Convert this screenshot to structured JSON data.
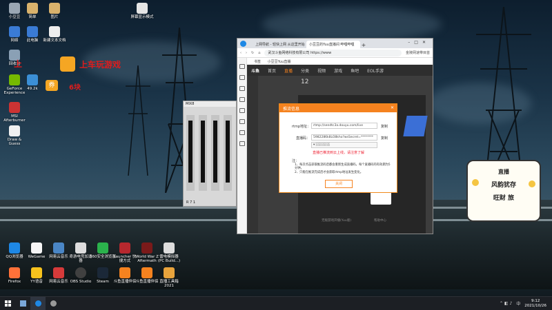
{
  "desktop": {
    "icons": [
      {
        "label": "小豆豆",
        "color": "#9aa7b4"
      },
      {
        "label": "简单",
        "color": "#d9b26c"
      },
      {
        "label": "图片",
        "color": "#d9b26c"
      },
      {
        "label": "网络",
        "color": "#3a7bd5"
      },
      {
        "label": "此电脑",
        "color": "#3a7bd5"
      },
      {
        "label": "新建文本文档",
        "color": "#eeeeee"
      },
      {
        "label": "回收站",
        "color": "#8aa0b5"
      },
      {
        "label": "49.2k",
        "color": "#3b8fd6"
      },
      {
        "label": "GeForce Experience",
        "color": "#76b900"
      },
      {
        "label": "MSI Afterburner",
        "color": "#c33"
      },
      {
        "label": "Draw & Guess",
        "color": "#f0f0f0"
      },
      {
        "label": "屏幕显示模式",
        "color": "#e5e5e5"
      },
      {
        "label": "QQ浏览器",
        "color": "#1e88e5"
      },
      {
        "label": "WeGame",
        "color": "#f5f5f5"
      },
      {
        "label": "网易云音乐",
        "color": "#4a86c5"
      },
      {
        "label": "奇游电竞加速器",
        "color": "#ddd"
      },
      {
        "label": "360安全浏览器",
        "color": "#2bb24c"
      },
      {
        "label": "Launcher 快捷方式",
        "color": "#b7282e"
      },
      {
        "label": "World War Z Aftermath",
        "color": "#7a1a1a"
      },
      {
        "label": "雷电模拟器 (PC Build...)",
        "color": "#ddd"
      },
      {
        "label": "Firefox",
        "color": "#ff7139"
      },
      {
        "label": "YY语音",
        "color": "#f8c31d"
      },
      {
        "label": "网易云音乐",
        "color": "#d63a3a"
      },
      {
        "label": "OBS Studio",
        "color": "#404040"
      },
      {
        "label": "Steam",
        "color": "#1b2838"
      },
      {
        "label": "斗鱼直播伴侣",
        "color": "#f5821f"
      },
      {
        "label": "斗鱼直播伴侣",
        "color": "#f5821f"
      },
      {
        "label": "直播工具箱 2021",
        "color": "#e8a33c"
      }
    ],
    "banner1_prefix": "上",
    "banner1_text": "上车玩游戏",
    "banner2_text": "券",
    "banner2_value": "6块"
  },
  "browser": {
    "tabs": [
      {
        "title": "上网导航 - 轻快上网 从这里开始"
      },
      {
        "title": "小豆豆的Yuu直播间 哔哩哔哩"
      }
    ],
    "address_url": "武汉斗鱼网络科技有限公司 https://www",
    "address_right": "金陵网速带目首",
    "bookmark": "书签",
    "bookmark2": "小豆豆Yuu直播",
    "site_nav": [
      "首页",
      "直播",
      "分类",
      "视频",
      "游戏",
      "鱼吧",
      "EOL手游"
    ],
    "score": "12",
    "footer_left": "无敌游戏开播(Yuu版)",
    "footer_right": "帮助中心"
  },
  "modal": {
    "title": "推流信息",
    "rtmp_label": "rtmp地址：",
    "rtmp_value": "rtmp://sendtc3a.douyu.com/live",
    "copy1": "复制",
    "key_label": "直播码：",
    "key_value": "5982286k8LO8kho?wsSecret=********",
    "copy2": "复制",
    "select_value": "▾ ░░░░░░",
    "warning": "直播已推流到云上线，请注意了解",
    "note_title": "注：",
    "notes": [
      "1、每次点击获取推流码后都会重新生成直播码，每个直播码的有效期为5分钟。",
      "2、只能在推流完成后才会获取rtmp地址发生变化。"
    ],
    "close_button": "关闭"
  },
  "mixer": {
    "title": "MIX8",
    "footer": "R 7 1"
  },
  "card": {
    "line1": "直播",
    "line2": "风韵犹存",
    "line3": "旺财 旅"
  },
  "overlay_top": {
    "label": "屏幕显示模式"
  },
  "taskbar": {
    "time": "9:12",
    "date": "2021/10/26",
    "lang": "中"
  }
}
